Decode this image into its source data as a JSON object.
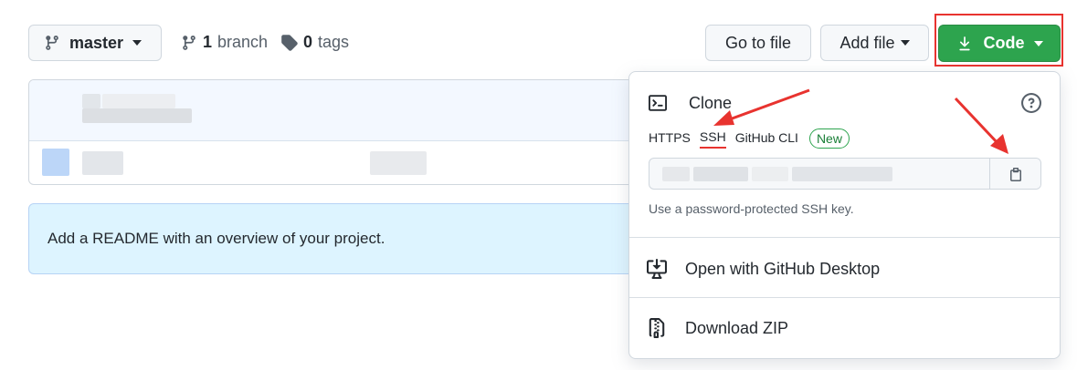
{
  "toolbar": {
    "branch_label": "master",
    "branch_count": "1",
    "branch_word": "branch",
    "tag_count": "0",
    "tag_word": "tags",
    "go_to_file": "Go to file",
    "add_file": "Add file",
    "code": "Code"
  },
  "readme_prompt": "Add a README with an overview of your project.",
  "clone": {
    "title": "Clone",
    "tabs": [
      "HTTPS",
      "SSH",
      "GitHub CLI"
    ],
    "active_tab": "SSH",
    "new_badge": "New",
    "hint": "Use a password-protected SSH key.",
    "open_desktop": "Open with GitHub Desktop",
    "download_zip": "Download ZIP"
  },
  "colors": {
    "primary_green": "#2da44e",
    "annotation_red": "#e8332f",
    "info_blue": "#ddf4ff"
  }
}
